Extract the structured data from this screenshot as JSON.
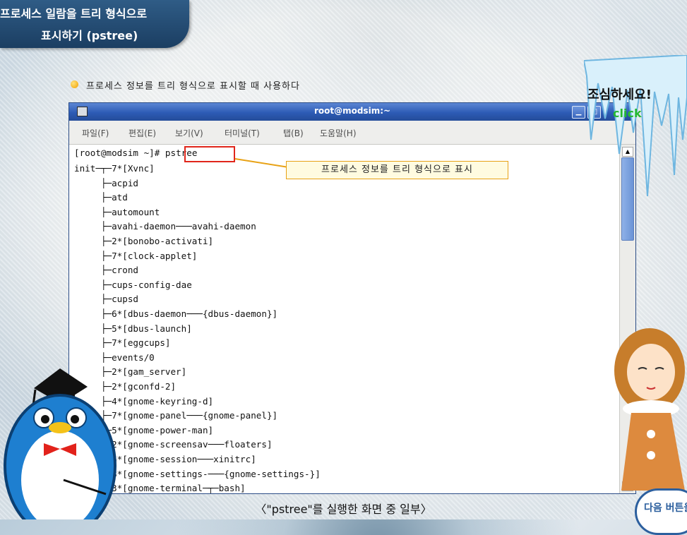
{
  "header": {
    "title_line1": "프로세스 일람을 트리 형식으로",
    "title_line2": "표시하기 (pstree)"
  },
  "bullet_text": "프로세스 정보를 트리 형식으로 표시할 때 사용하다",
  "window": {
    "title": "root@modsim:~",
    "menu": [
      "파일(F)",
      "편집(E)",
      "보기(V)",
      "터미널(T)",
      "탭(B)",
      "도움말(H)"
    ]
  },
  "terminal": {
    "prompt": "[root@modsim ~]# ",
    "command": "pstree",
    "lines": [
      "init─┬─7*[Xvnc]",
      "     ├─acpid",
      "     ├─atd",
      "     ├─automount",
      "     ├─avahi-daemon───avahi-daemon",
      "     ├─2*[bonobo-activati]",
      "     ├─7*[clock-applet]",
      "     ├─crond",
      "     ├─cups-config-dae",
      "     ├─cupsd",
      "     ├─6*[dbus-daemon───{dbus-daemon}]",
      "     ├─5*[dbus-launch]",
      "     ├─7*[eggcups]",
      "     ├─events/0",
      "     ├─2*[gam_server]",
      "     ├─2*[gconfd-2]",
      "     ├─4*[gnome-keyring-d]",
      "     ├─7*[gnome-panel───{gnome-panel}]",
      "     ├─5*[gnome-power-man]",
      "     ├─2*[gnome-screensav───floaters]",
      "     ├─6*[gnome-session───xinitrc]",
      "     ├─8*[gnome-settings-───{gnome-settings-}]",
      "     ├─3*[gnome-terminal─┬─bash]"
    ]
  },
  "callout": "프로세스 정보를 트리 형식으로 표시",
  "caption": "〈\"pstree\"를 실행한 화면 중 일부〉",
  "warning": {
    "text": "조심하세요!",
    "click": "click"
  },
  "next_button": "다음 버튼을",
  "colors": {
    "title_bg": "#1f4a74",
    "highlight": "#e0261b",
    "callout_border": "#e8a216",
    "click": "#26b830"
  }
}
